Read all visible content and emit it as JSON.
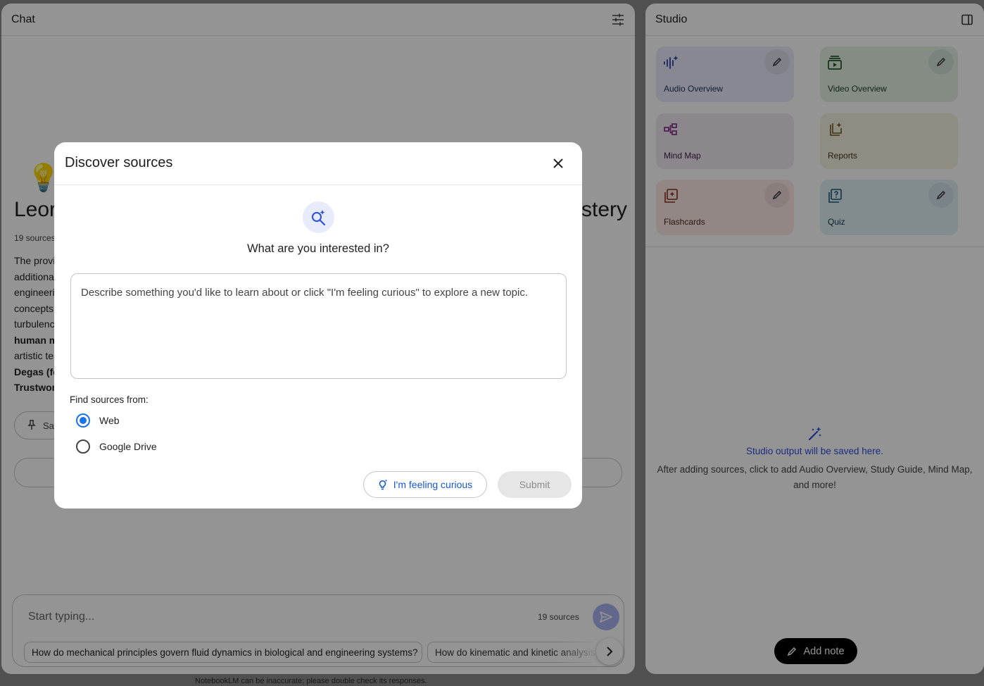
{
  "chat": {
    "title": "Chat",
    "heading_start": "Leor",
    "heading_end": "stery",
    "sources_count": "19 sources",
    "body_fragments": [
      "The provi",
      "additiona",
      "engineeri",
      "concepts",
      "turbulenc",
      "human m",
      "artistic te",
      "Degas (fo",
      "Trustwor"
    ],
    "save_chip": "Sa",
    "composer_placeholder": "Start typing...",
    "composer_sources": "19 sources",
    "suggestions": [
      "How do mechanical principles govern fluid dynamics in biological and engineering systems?",
      "How do kinematic and kinetic analysis"
    ],
    "disclaimer": "NotebookLM can be inaccurate; please double check its responses."
  },
  "studio": {
    "title": "Studio",
    "tiles": [
      {
        "label": "Audio Overview",
        "icon": "audio-waveform-icon",
        "editable": true
      },
      {
        "label": "Video Overview",
        "icon": "video-icon",
        "editable": true
      },
      {
        "label": "Mind Map",
        "icon": "mind-map-icon",
        "editable": false
      },
      {
        "label": "Reports",
        "icon": "reports-icon",
        "editable": false
      },
      {
        "label": "Flashcards",
        "icon": "flashcards-icon",
        "editable": true
      },
      {
        "label": "Quiz",
        "icon": "quiz-icon",
        "editable": true
      }
    ],
    "empty_title": "Studio output will be saved here.",
    "empty_desc": "After adding sources, click to add Audio Overview, Study Guide, Mind Map, and more!",
    "add_note": "Add note"
  },
  "dialog": {
    "title": "Discover sources",
    "question": "What are you interested in?",
    "textarea_placeholder": "Describe something you'd like to learn about or click \"I'm feeling curious\" to explore a new topic.",
    "find_label": "Find sources from:",
    "options": [
      {
        "label": "Web",
        "selected": true
      },
      {
        "label": "Google Drive",
        "selected": false
      }
    ],
    "curious_button": "I'm feeling curious",
    "submit_button": "Submit"
  },
  "colors": {
    "accent": "#1a73e8",
    "link_blue": "#2d4ee0",
    "send_button": "#a7b4f0"
  }
}
